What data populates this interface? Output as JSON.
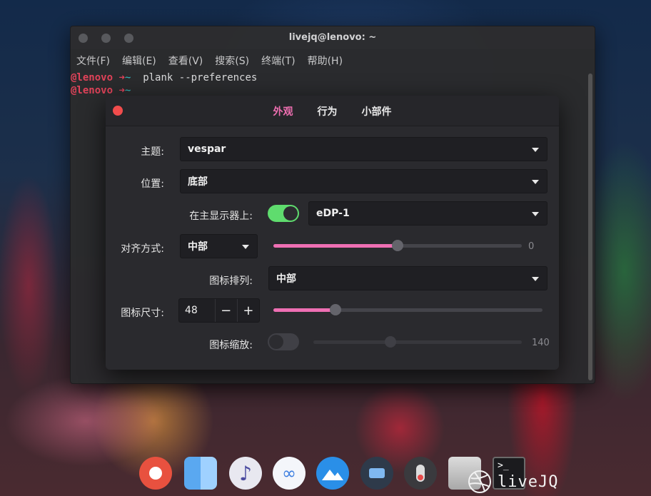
{
  "terminal": {
    "title": "livejq@lenovo: ~",
    "menu": [
      "文件(F)",
      "编辑(E)",
      "查看(V)",
      "搜索(S)",
      "终端(T)",
      "帮助(H)"
    ],
    "lines": [
      {
        "host": "@lenovo",
        "arrow": "➜",
        "dir": "~",
        "cmd": "plank --preferences"
      },
      {
        "host": "@lenovo",
        "arrow": "➜",
        "dir": "~",
        "cmd": ""
      }
    ]
  },
  "dialog": {
    "tabs": [
      "外观",
      "行为",
      "小部件"
    ],
    "active_tab": 0,
    "theme": {
      "label": "主题:",
      "value": "vespar"
    },
    "position": {
      "label": "位置:",
      "value": "底部"
    },
    "primary_display": {
      "label": "在主显示器上:",
      "enabled": true,
      "value": "eDP-1"
    },
    "alignment": {
      "label": "对齐方式:",
      "value": "中部",
      "offset_value": "0",
      "offset_fraction": 0.5
    },
    "icon_layout": {
      "label": "图标排列:",
      "value": "中部"
    },
    "icon_size": {
      "label": "图标尺寸:",
      "value": "48",
      "minus": "−",
      "plus": "+",
      "slider_fraction": 0.23
    },
    "icon_zoom": {
      "label": "图标缩放:",
      "enabled": false,
      "value": "140",
      "slider_fraction": 0.37
    }
  },
  "dock": {
    "icons": [
      "record-icon",
      "finder-icon",
      "music-icon",
      "cloud-sync-icon",
      "image-viewer-icon",
      "chat-icon",
      "toggle-app-icon",
      "drive-icon",
      "terminal-icon"
    ],
    "terminal_glyph": ">_"
  },
  "watermark": {
    "text": "liveJQ"
  },
  "colors": {
    "accent": "#ef6fb1",
    "switch_on": "#5fdc6e",
    "close": "#f14c4c"
  }
}
